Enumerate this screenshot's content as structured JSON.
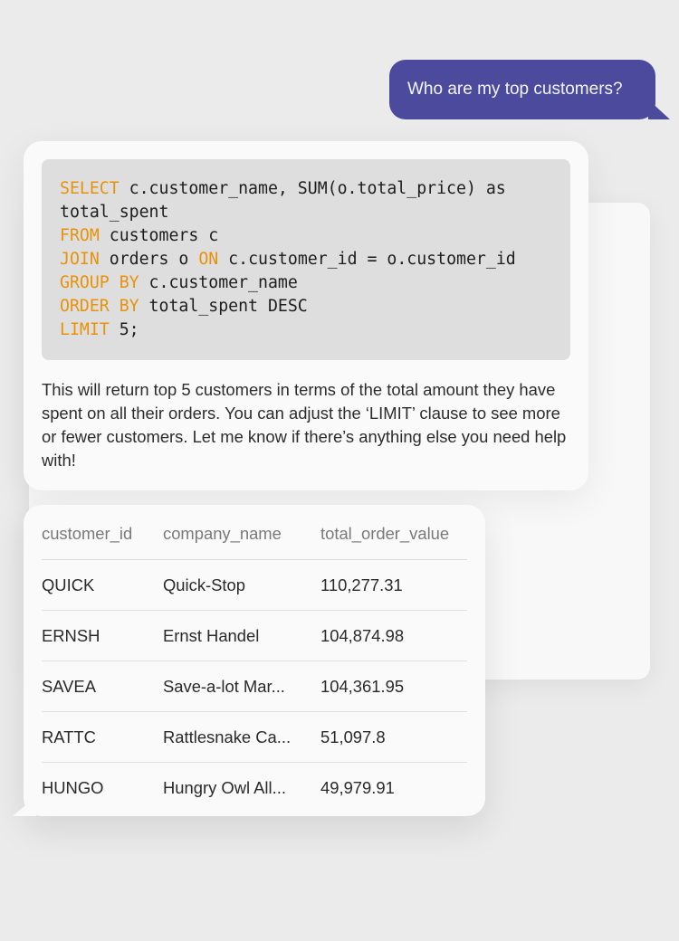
{
  "user_message": "Who are my top customers?",
  "sql": {
    "lines": [
      [
        {
          "t": "SELECT",
          "kw": true
        },
        {
          "t": " c.customer_name, SUM(o.total_price) as",
          "kw": false
        }
      ],
      [
        {
          "t": "total_spent",
          "kw": false
        }
      ],
      [
        {
          "t": "FROM",
          "kw": true
        },
        {
          "t": " customers c",
          "kw": false
        }
      ],
      [
        {
          "t": "JOIN",
          "kw": true
        },
        {
          "t": " orders o ",
          "kw": false
        },
        {
          "t": "ON",
          "kw": true
        },
        {
          "t": " c.customer_id = o.customer_id",
          "kw": false
        }
      ],
      [
        {
          "t": "GROUP BY",
          "kw": true
        },
        {
          "t": " c.customer_name",
          "kw": false
        }
      ],
      [
        {
          "t": "ORDER BY",
          "kw": true
        },
        {
          "t": " total_spent DESC",
          "kw": false
        }
      ],
      [
        {
          "t": "LIMIT",
          "kw": true
        },
        {
          "t": " 5;",
          "kw": false
        }
      ]
    ],
    "keyword_color": "#e8920b"
  },
  "explanation": "This will return top 5 customers in terms of the total amount they have spent on all their orders. You can adjust the ‘LIMIT’ clause to see more or fewer customers. Let me know if there’s anything else you need help with!",
  "results": {
    "columns": [
      "customer_id",
      "company_name",
      "total_order_value"
    ],
    "rows": [
      [
        "QUICK",
        "Quick-Stop",
        "110,277.31"
      ],
      [
        "ERNSH",
        "Ernst Handel",
        "104,874.98"
      ],
      [
        "SAVEA",
        "Save-a-lot Mar...",
        "104,361.95"
      ],
      [
        "RATTC",
        "Rattlesnake Ca...",
        "51,097.8"
      ],
      [
        "HUNGO",
        "Hungry Owl All...",
        "49,979.91"
      ]
    ]
  },
  "colors": {
    "user_bubble": "#4b4a9c",
    "background": "#ebebeb",
    "card": "#fafafa"
  }
}
